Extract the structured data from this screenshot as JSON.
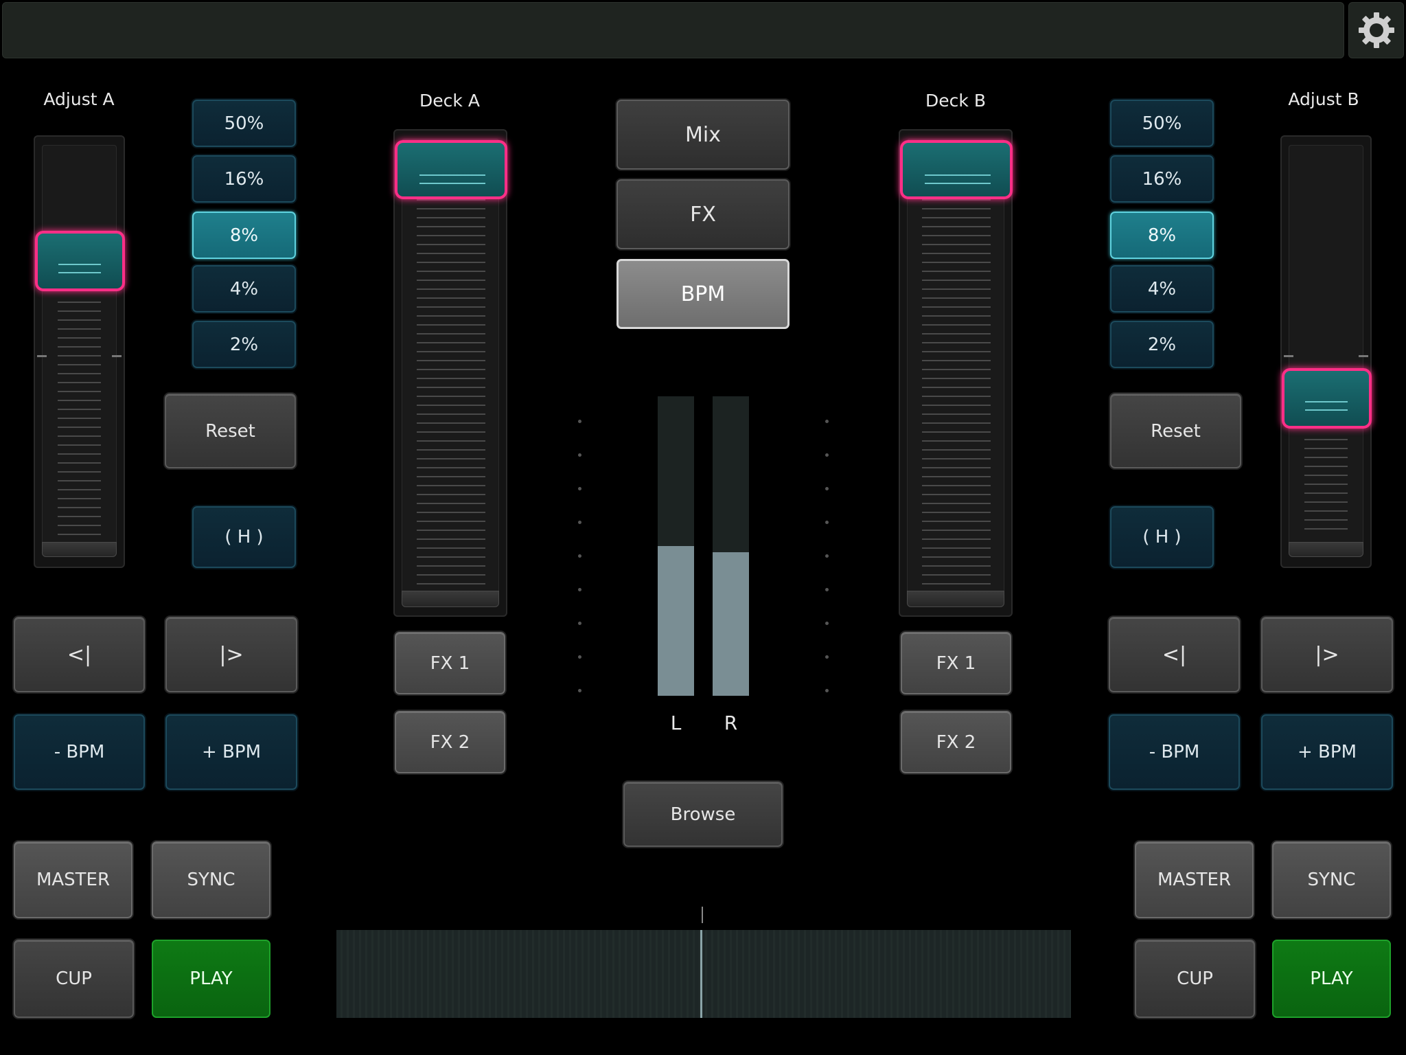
{
  "deck_a": {
    "adjust_label": "Adjust A",
    "deck_label": "Deck A",
    "percent_buttons": [
      "50%",
      "16%",
      "8%",
      "4%",
      "2%"
    ],
    "selected_percent": "8%",
    "reset": "Reset",
    "hold": "( H )",
    "nudge_back": "<|",
    "nudge_fwd": "|>",
    "bpm_minus": "- BPM",
    "bpm_plus": "+ BPM",
    "master": "MASTER",
    "sync": "SYNC",
    "cup": "CUP",
    "play": "PLAY",
    "fx1": "FX 1",
    "fx2": "FX 2",
    "adjust_level": 0.25,
    "volume_level": 1.0
  },
  "deck_b": {
    "adjust_label": "Adjust B",
    "deck_label": "Deck B",
    "percent_buttons": [
      "50%",
      "16%",
      "8%",
      "4%",
      "2%"
    ],
    "selected_percent": "8%",
    "reset": "Reset",
    "hold": "( H )",
    "nudge_back": "<|",
    "nudge_fwd": "|>",
    "bpm_minus": "- BPM",
    "bpm_plus": "+ BPM",
    "master": "MASTER",
    "sync": "SYNC",
    "cup": "CUP",
    "play": "PLAY",
    "fx1": "FX 1",
    "fx2": "FX 2",
    "adjust_level": 0.65,
    "volume_level": 1.0
  },
  "center": {
    "mode_buttons": [
      "Mix",
      "FX",
      "BPM"
    ],
    "selected_mode": "BPM",
    "browse": "Browse",
    "meter_left_label": "L",
    "meter_right_label": "R",
    "meter_left_level": 0.5,
    "meter_right_level": 0.48
  },
  "icons": {
    "settings": "gear-icon"
  },
  "colors": {
    "accent_teal": "#1f7f8c",
    "knob_highlight": "#ff2f87",
    "play_green": "#0e7a14",
    "background": "#000000"
  }
}
